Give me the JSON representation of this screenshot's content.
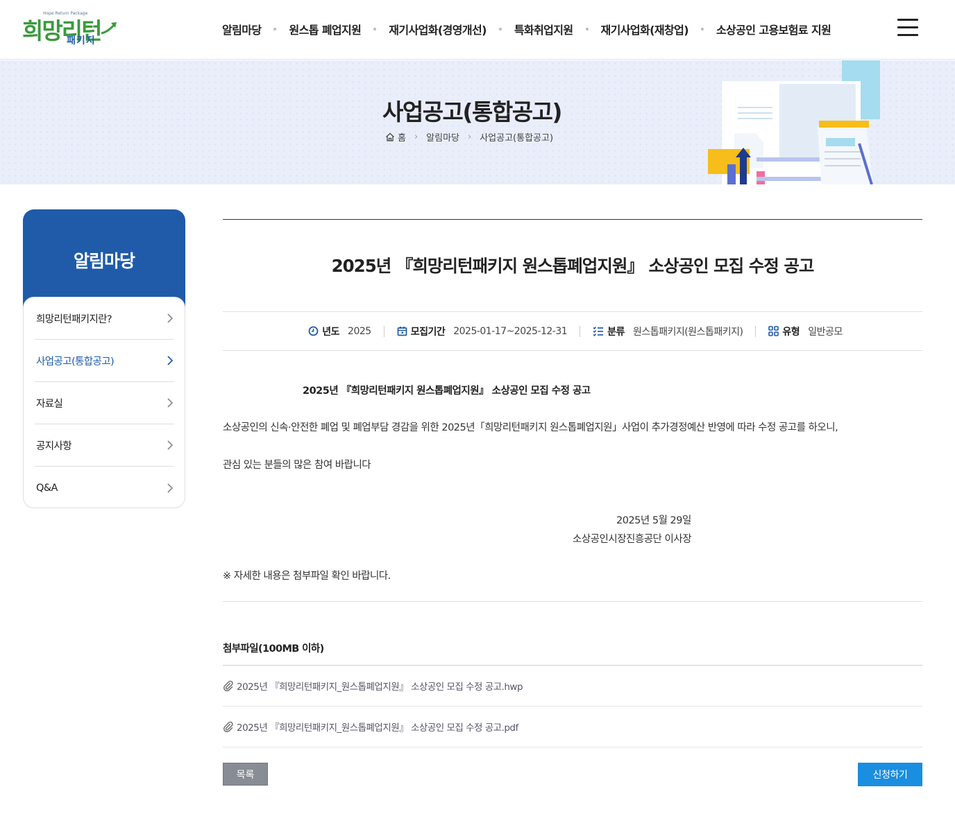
{
  "header": {
    "logo": {
      "tagline": "Hope Return Package",
      "main": "희망리턴",
      "sub": "패키지"
    },
    "nav": [
      "알림마당",
      "원스톱 폐업지원",
      "재기사업화(경영개선)",
      "특화취업지원",
      "재기사업화(재창업)",
      "소상공인 고용보험료 지원"
    ],
    "menu_icon": "hamburger-menu-icon"
  },
  "visual": {
    "title": "사업공고(통합공고)",
    "breadcrumb": [
      "홈",
      "알림마당",
      "사업공고(통합공고)"
    ]
  },
  "lnb": {
    "title": "알림마당",
    "items": [
      {
        "label": "희망리턴패키지란?",
        "active": false
      },
      {
        "label": "사업공고(통합공고)",
        "active": true
      },
      {
        "label": "자료실",
        "active": false
      },
      {
        "label": "공지사항",
        "active": false
      },
      {
        "label": "Q&A",
        "active": false
      }
    ]
  },
  "post": {
    "title": "2025년 『희망리턴패키지 원스톱폐업지원』 소상공인 모집 수정 공고",
    "meta": {
      "year_label": "년도",
      "year_value": "2025",
      "period_label": "모집기간",
      "period_value": "2025-01-17~2025-12-31",
      "category_label": "분류",
      "category_value": "원스톱패키지(원스톱패키지)",
      "type_label": "유형",
      "type_value": "일반공모"
    },
    "body": {
      "title": "2025년 『희망리턴패키지 원스톱폐업지원』 소상공인 모집 수정 공고",
      "line1": "소상공인의 신속·안전한 폐업 및 폐업부담 경감을 위한 2025년「희망리턴패키지 원스톱폐업지원」사업이 추가경정예산 반영에 따라 수정 공고를 하오니,",
      "line2": "관심 있는 분들의 많은 참여 바랍니다",
      "date": "2025년 5월 29일",
      "signer": "소상공인시장진흥공단 이사장",
      "note": "※ 자세한 내용은 첨부파일 확인 바랍니다."
    },
    "attachments_title": "첨부파일(100MB 이하)",
    "attachments": [
      "2025년 『희망리턴패키지_원스톱폐업지원』 소상공인 모집 수정 공고.hwp",
      "2025년 『희망리턴패키지_원스톱폐업지원』 소상공인 모집 수정 공고.pdf"
    ]
  },
  "buttons": {
    "list": "목록",
    "apply": "신청하기"
  },
  "colors": {
    "primary": "#1f5ba8",
    "apply": "#1a8ee0",
    "list": "#888c94",
    "banner": "#e9eefa"
  }
}
